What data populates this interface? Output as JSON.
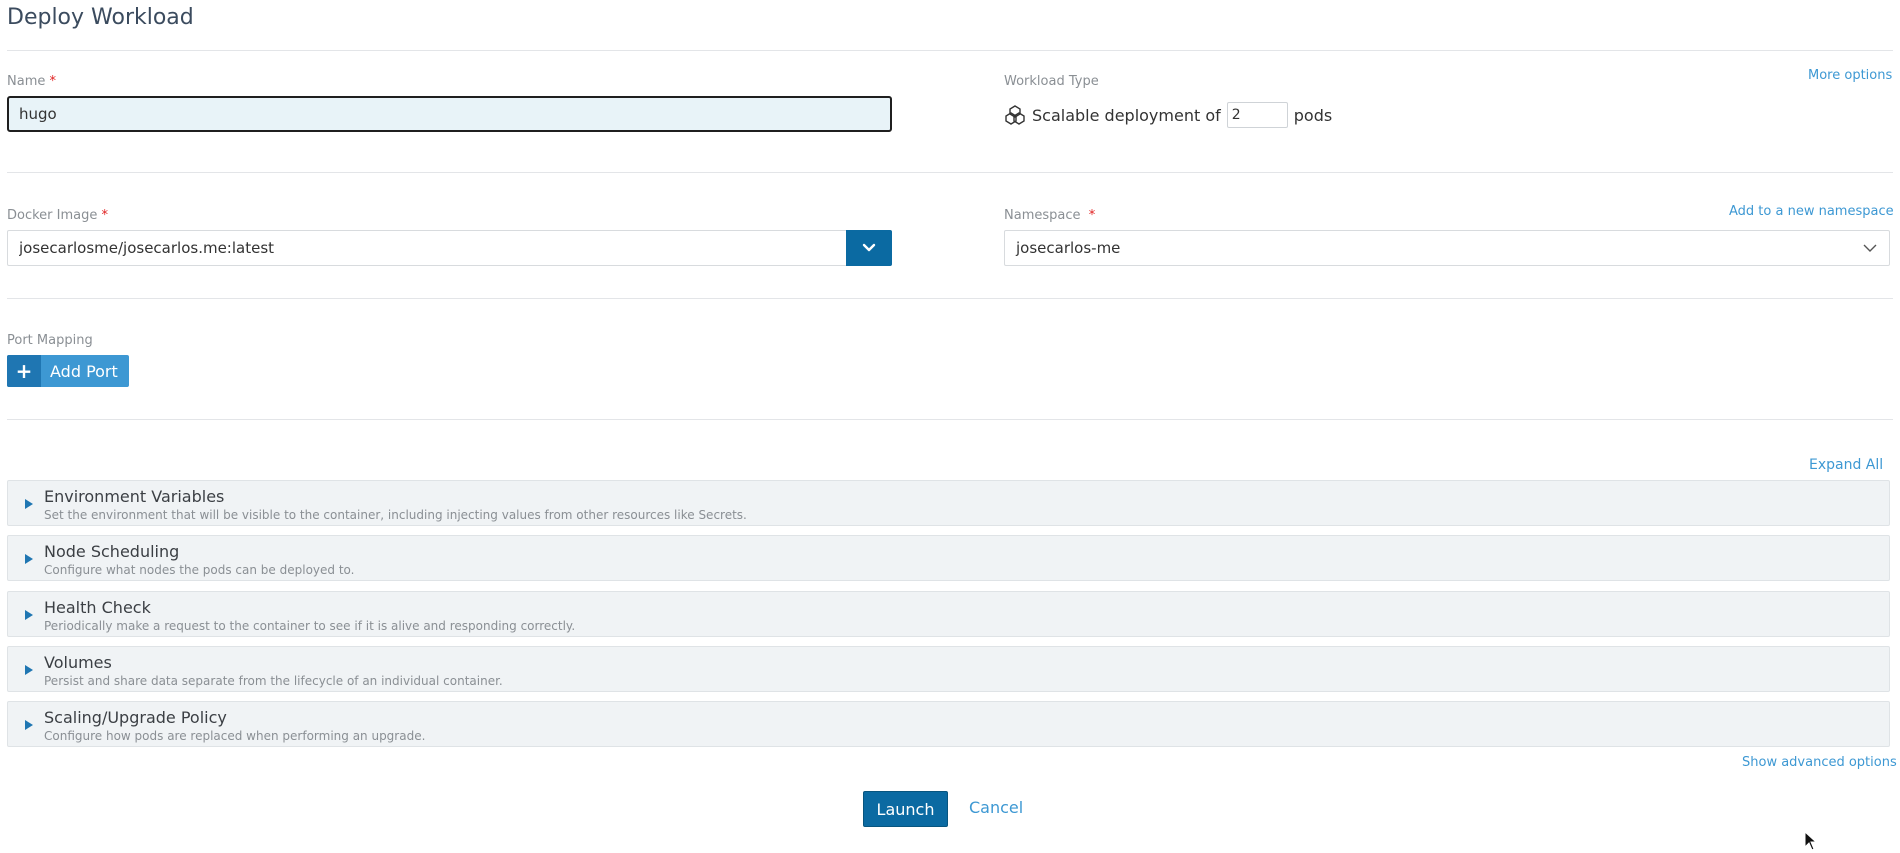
{
  "page": {
    "title": "Deploy Workload"
  },
  "name_field": {
    "label": "Name",
    "required_mark": "*",
    "value": "hugo"
  },
  "workload_type": {
    "label": "Workload Type",
    "more_options": "More options",
    "prefix": "Scalable deployment of",
    "pods_value": "2",
    "suffix": "pods",
    "icon": "cluster-icon"
  },
  "docker_image": {
    "label": "Docker Image",
    "required_mark": "*",
    "value": "josecarlosme/josecarlos.me:latest",
    "dropdown_icon": "chevron-down-icon"
  },
  "namespace": {
    "label": "Namespace",
    "required_mark": "*",
    "add_new": "Add to a new namespace",
    "selected": "josecarlos-me"
  },
  "port_mapping": {
    "label": "Port Mapping",
    "add_port": "Add Port",
    "plus": "+"
  },
  "sections": {
    "expand_all": "Expand All",
    "items": [
      {
        "title": "Environment Variables",
        "description": "Set the environment that will be visible to the container, including injecting values from other resources like Secrets."
      },
      {
        "title": "Node Scheduling",
        "description": "Configure what nodes the pods can be deployed to."
      },
      {
        "title": "Health Check",
        "description": "Periodically make a request to the container to see if it is alive and responding correctly."
      },
      {
        "title": "Volumes",
        "description": "Persist and share data separate from the lifecycle of an individual container."
      },
      {
        "title": "Scaling/Upgrade Policy",
        "description": "Configure how pods are replaced when performing an upgrade."
      }
    ],
    "show_advanced": "Show advanced options"
  },
  "actions": {
    "launch": "Launch",
    "cancel": "Cancel"
  },
  "colors": {
    "primary": "#0b6aa2",
    "link": "#3d98d3",
    "required": "#e02020",
    "section_bg": "#f0f3f5"
  }
}
